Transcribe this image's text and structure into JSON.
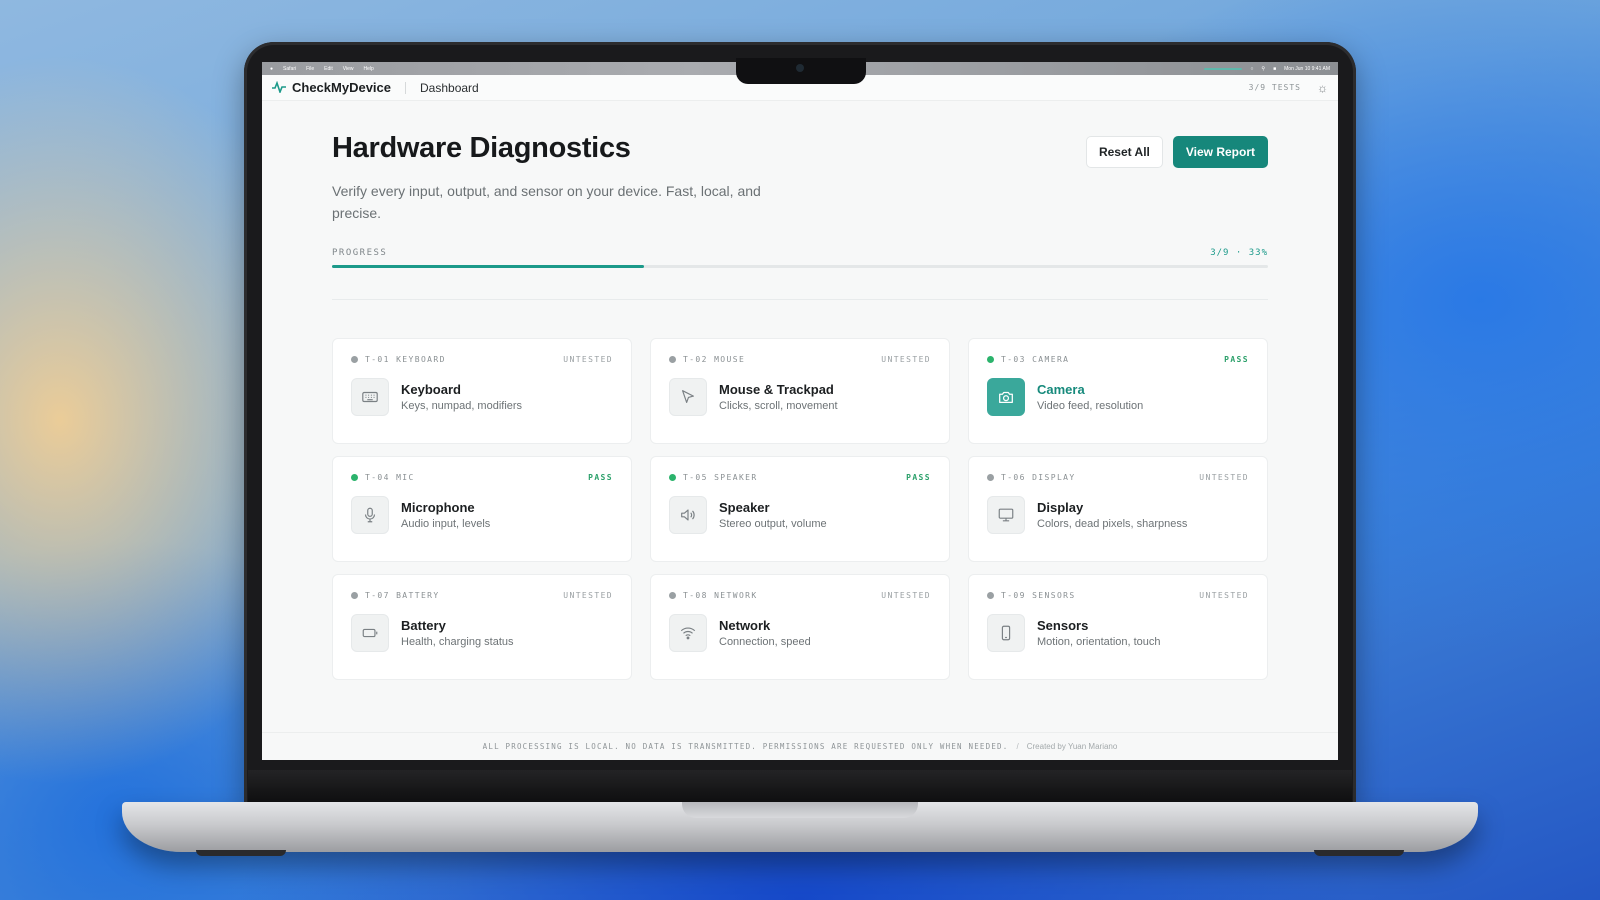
{
  "menubar": {
    "items": [
      "Safari",
      "File",
      "Edit",
      "View",
      "Help"
    ],
    "clock": "Mon Jun 10  9:41 AM"
  },
  "app": {
    "name": "CheckMyDevice",
    "breadcrumb": "Dashboard",
    "tests_count": "3/9 TESTS"
  },
  "page": {
    "title": "Hardware Diagnostics",
    "subtitle": "Verify every input, output, and sensor on your device. Fast, local, and precise.",
    "reset_label": "Reset All",
    "view_label": "View Report"
  },
  "progress": {
    "label": "PROGRESS",
    "value_text": "3/9 · 33%",
    "fraction": 0.333
  },
  "tests": [
    {
      "code": "T-01 KEYBOARD",
      "status": "UNTESTED",
      "title": "Keyboard",
      "desc": "Keys, numpad, modifiers",
      "icon": "keyboard-icon"
    },
    {
      "code": "T-02 MOUSE",
      "status": "UNTESTED",
      "title": "Mouse & Trackpad",
      "desc": "Clicks, scroll, movement",
      "icon": "cursor-icon"
    },
    {
      "code": "T-03 CAMERA",
      "status": "PASS",
      "title": "Camera",
      "desc": "Video feed, resolution",
      "icon": "camera-icon"
    },
    {
      "code": "T-04 MIC",
      "status": "PASS",
      "title": "Microphone",
      "desc": "Audio input, levels",
      "icon": "microphone-icon"
    },
    {
      "code": "T-05 SPEAKER",
      "status": "PASS",
      "title": "Speaker",
      "desc": "Stereo output, volume",
      "icon": "speaker-icon"
    },
    {
      "code": "T-06 DISPLAY",
      "status": "UNTESTED",
      "title": "Display",
      "desc": "Colors, dead pixels, sharpness",
      "icon": "monitor-icon"
    },
    {
      "code": "T-07 BATTERY",
      "status": "UNTESTED",
      "title": "Battery",
      "desc": "Health, charging status",
      "icon": "battery-icon"
    },
    {
      "code": "T-08 NETWORK",
      "status": "UNTESTED",
      "title": "Network",
      "desc": "Connection, speed",
      "icon": "wifi-icon"
    },
    {
      "code": "T-09 SENSORS",
      "status": "UNTESTED",
      "title": "Sensors",
      "desc": "Motion, orientation, touch",
      "icon": "phone-icon"
    }
  ],
  "footer": {
    "note": "ALL PROCESSING IS LOCAL. NO DATA IS TRANSMITTED. PERMISSIONS ARE REQUESTED ONLY WHEN NEEDED.",
    "separator": "/",
    "credit": "Created by Yuan Mariano"
  },
  "colors": {
    "accent": "#16877b",
    "pass": "#2ba06a",
    "untested": "#9aa0a3"
  }
}
